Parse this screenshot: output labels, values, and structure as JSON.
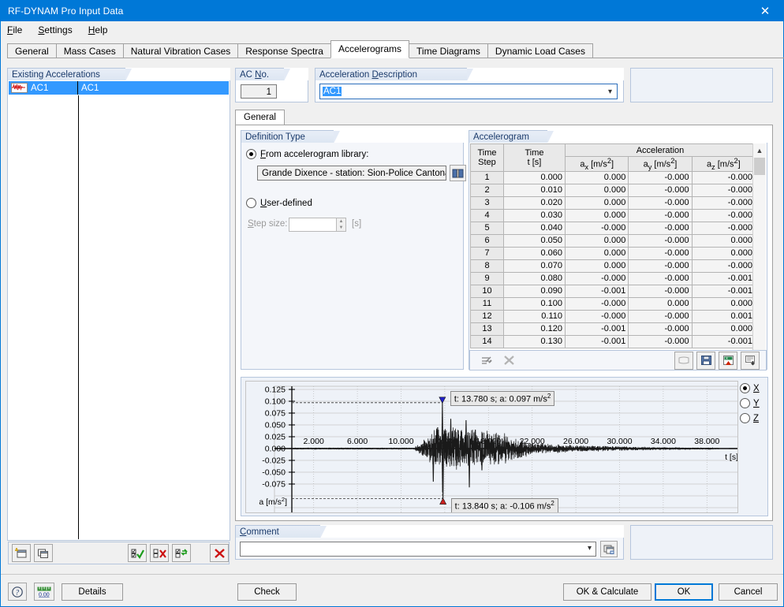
{
  "window": {
    "title": "RF-DYNAM Pro Input Data",
    "close_icon": "close-icon"
  },
  "menu": {
    "items": [
      "File",
      "Settings",
      "Help"
    ]
  },
  "tabs": {
    "items": [
      "General",
      "Mass Cases",
      "Natural Vibration Cases",
      "Response Spectra",
      "Accelerograms",
      "Time Diagrams",
      "Dynamic Load Cases"
    ],
    "active": "Accelerograms"
  },
  "left_panel": {
    "caption": "Existing Accelerations",
    "rows": [
      {
        "icon": "accelerogram-icon",
        "name": "AC1",
        "description": "AC1",
        "selected": true
      }
    ],
    "toolbar": [
      "new-icon",
      "copy-icon",
      "select-all-icon",
      "deselect-all-icon",
      "invert-selection-icon",
      "delete-icon"
    ]
  },
  "ac_no": {
    "caption": "AC No.",
    "caption_accel": "N",
    "value": "1"
  },
  "acc_description": {
    "caption": "Acceleration Description",
    "caption_accel": "D",
    "value": "AC1"
  },
  "inner_tab": {
    "label": "General"
  },
  "definition_type": {
    "caption": "Definition Type",
    "from_library": {
      "label": "From accelerogram library:",
      "selected": true,
      "value": "Grande Dixence - station: Sion-Police Cantonal",
      "browse_icon": "library-book-icon"
    },
    "user_defined": {
      "label": "User-defined",
      "selected": false
    },
    "step_size": {
      "label": "Step size:",
      "value": "",
      "unit": "[s]",
      "enabled": false
    }
  },
  "accelerogram_table": {
    "caption": "Accelerogram",
    "group_header": "Acceleration",
    "headers": {
      "step_l1": "Time",
      "step_l2": "Step",
      "time_l1": "Time",
      "time_l2": "t [s]",
      "ax": "a x [m/s2]",
      "ay": "a y [m/s2]",
      "az": "a z [m/s2]"
    },
    "rows": [
      {
        "step": "1",
        "t": "0.000",
        "ax": "0.000",
        "ay": "-0.000",
        "az": "-0.000"
      },
      {
        "step": "2",
        "t": "0.010",
        "ax": "0.000",
        "ay": "-0.000",
        "az": "-0.000"
      },
      {
        "step": "3",
        "t": "0.020",
        "ax": "0.000",
        "ay": "-0.000",
        "az": "-0.000"
      },
      {
        "step": "4",
        "t": "0.030",
        "ax": "0.000",
        "ay": "-0.000",
        "az": "-0.000"
      },
      {
        "step": "5",
        "t": "0.040",
        "ax": "-0.000",
        "ay": "-0.000",
        "az": "-0.000"
      },
      {
        "step": "6",
        "t": "0.050",
        "ax": "0.000",
        "ay": "-0.000",
        "az": "0.000"
      },
      {
        "step": "7",
        "t": "0.060",
        "ax": "0.000",
        "ay": "-0.000",
        "az": "0.000"
      },
      {
        "step": "8",
        "t": "0.070",
        "ax": "0.000",
        "ay": "-0.000",
        "az": "-0.000"
      },
      {
        "step": "9",
        "t": "0.080",
        "ax": "-0.000",
        "ay": "-0.000",
        "az": "-0.001"
      },
      {
        "step": "10",
        "t": "0.090",
        "ax": "-0.001",
        "ay": "-0.000",
        "az": "-0.001"
      },
      {
        "step": "11",
        "t": "0.100",
        "ax": "-0.000",
        "ay": "0.000",
        "az": "0.000"
      },
      {
        "step": "12",
        "t": "0.110",
        "ax": "-0.000",
        "ay": "-0.000",
        "az": "0.001"
      },
      {
        "step": "13",
        "t": "0.120",
        "ax": "-0.001",
        "ay": "-0.000",
        "az": "0.000"
      },
      {
        "step": "14",
        "t": "0.130",
        "ax": "-0.001",
        "ay": "-0.000",
        "az": "-0.001"
      }
    ],
    "toolbar": [
      "clear-row-icon",
      "delete-row-icon",
      "import-icon",
      "save-icon",
      "excel-export-icon",
      "excel-import-icon"
    ]
  },
  "chart_data": {
    "type": "line",
    "title": "",
    "xlabel": "t [s]",
    "ylabel": "a [m/s2]",
    "xlim": [
      0,
      40
    ],
    "ylim": [
      -0.125,
      0.125
    ],
    "xticks": [
      "2.000",
      "6.000",
      "10.000",
      "14.000",
      "18.000",
      "22.000",
      "26.000",
      "30.000",
      "34.000",
      "38.000"
    ],
    "xtick_values": [
      2,
      6,
      10,
      14,
      18,
      22,
      26,
      30,
      34,
      38
    ],
    "yticks": [
      "0.125",
      "0.100",
      "0.075",
      "0.050",
      "0.025",
      "0.000",
      "-0.025",
      "-0.050",
      "-0.075"
    ],
    "ytick_values": [
      0.125,
      0.1,
      0.075,
      0.05,
      0.025,
      0.0,
      -0.025,
      -0.05,
      -0.075
    ],
    "grid": true,
    "series_name": "a_x",
    "annotations": [
      {
        "name": "max-marker",
        "text": "t: 13.780 s; a: 0.097 m/s2",
        "t": 13.78,
        "a": 0.097,
        "marker": "triangle-down",
        "color": "#2222cc"
      },
      {
        "name": "min-marker",
        "text": "t: 13.840 s; a: -0.106 m/s2",
        "t": 13.84,
        "a": -0.106,
        "marker": "triangle-up",
        "color": "#cc2020"
      }
    ]
  },
  "axis_selector": {
    "options": [
      {
        "label": "X",
        "selected": true
      },
      {
        "label": "Y",
        "selected": false
      },
      {
        "label": "Z",
        "selected": false
      }
    ]
  },
  "comment": {
    "caption": "Comment",
    "caption_accel": "C",
    "value": "",
    "button_icon": "comment-library-icon"
  },
  "footer": {
    "help_icon": "help-icon",
    "units_icon": "units-icon",
    "details": "Details",
    "check": "Check",
    "ok_calculate": "OK & Calculate",
    "ok": "OK",
    "cancel": "Cancel"
  },
  "colors": {
    "accent": "#0078d7",
    "selection": "#3399ff",
    "caption_text": "#1a3a6b"
  }
}
